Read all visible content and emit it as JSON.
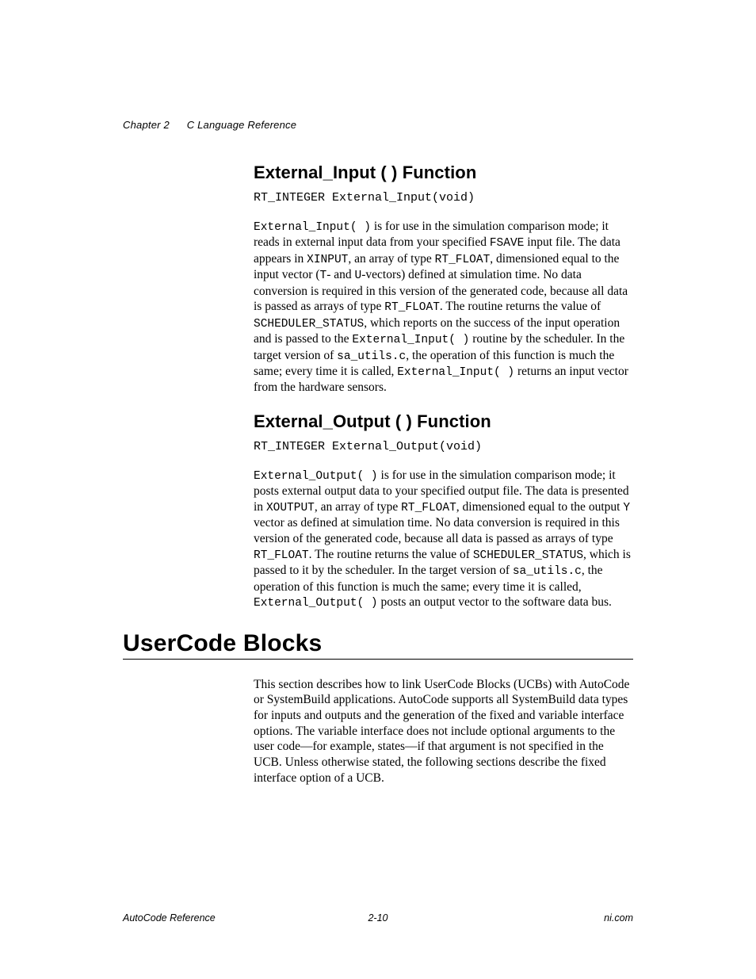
{
  "header": {
    "chapter": "Chapter 2",
    "title": "C Language Reference"
  },
  "sections": {
    "ext_input": {
      "heading": "External_Input ( ) Function",
      "signature": "RT_INTEGER External_Input(void)",
      "para_parts": {
        "t0": "External_Input( )",
        "t1": " is for use in the simulation comparison mode; it reads in external input data from your specified ",
        "t2": "FSAVE",
        "t3": " input file. The data appears in ",
        "t4": "XINPUT",
        "t5": ", an array of type ",
        "t6": "RT_FLOAT",
        "t7": ", dimensioned equal to the input vector (",
        "t8": "T",
        "t9": "- and ",
        "t10": "U",
        "t11": "-vectors) defined at simulation time. No data conversion is required in this version of the generated code, because all data is passed as arrays of type ",
        "t12": "RT_FLOAT",
        "t13": ". The routine returns the value of ",
        "t14": "SCHEDULER_STATUS",
        "t15": ", which reports on the success of the input operation and is passed to the ",
        "t16": "External_Input( )",
        "t17": " routine by the scheduler. In the target version of ",
        "t18": "sa_utils.c",
        "t19": ", the operation of this function is much the same; every time it is called, ",
        "t20": "External_Input( )",
        "t21": " returns an input vector from the hardware sensors."
      }
    },
    "ext_output": {
      "heading": "External_Output ( ) Function",
      "signature": "RT_INTEGER External_Output(void)",
      "para_parts": {
        "t0": "External_Output( )",
        "t1": " is for use in the simulation comparison mode; it posts external output data to your specified output file. The data is presented in ",
        "t2": "XOUTPUT",
        "t3": ", an array of type ",
        "t4": "RT_FLOAT",
        "t5": ", dimensioned equal to the output ",
        "t6": "Y",
        "t7": " vector as defined at simulation time. No data conversion is required in this version of the generated code, because all data is passed as arrays of type ",
        "t8": "RT_FLOAT",
        "t9": ". The routine returns the value of ",
        "t10": "SCHEDULER_STATUS",
        "t11": ", which is passed to it by the scheduler. In the target version of ",
        "t12": "sa_utils.c",
        "t13": ", the operation of this function is much the same; every time it is called, ",
        "t14": "External_Output( )",
        "t15": " posts an output vector to the software data bus."
      }
    },
    "usercode": {
      "heading": "UserCode Blocks",
      "para": "This section describes how to link UserCode Blocks (UCBs) with AutoCode or SystemBuild applications. AutoCode supports all SystemBuild data types for inputs and outputs and the generation of the fixed and variable interface options. The variable interface does not include optional arguments to the user code—for example, states—if that argument is not specified in the UCB. Unless otherwise stated, the following sections describe the fixed interface option of a UCB."
    }
  },
  "footer": {
    "left": "AutoCode Reference",
    "center": "2-10",
    "right": "ni.com"
  }
}
